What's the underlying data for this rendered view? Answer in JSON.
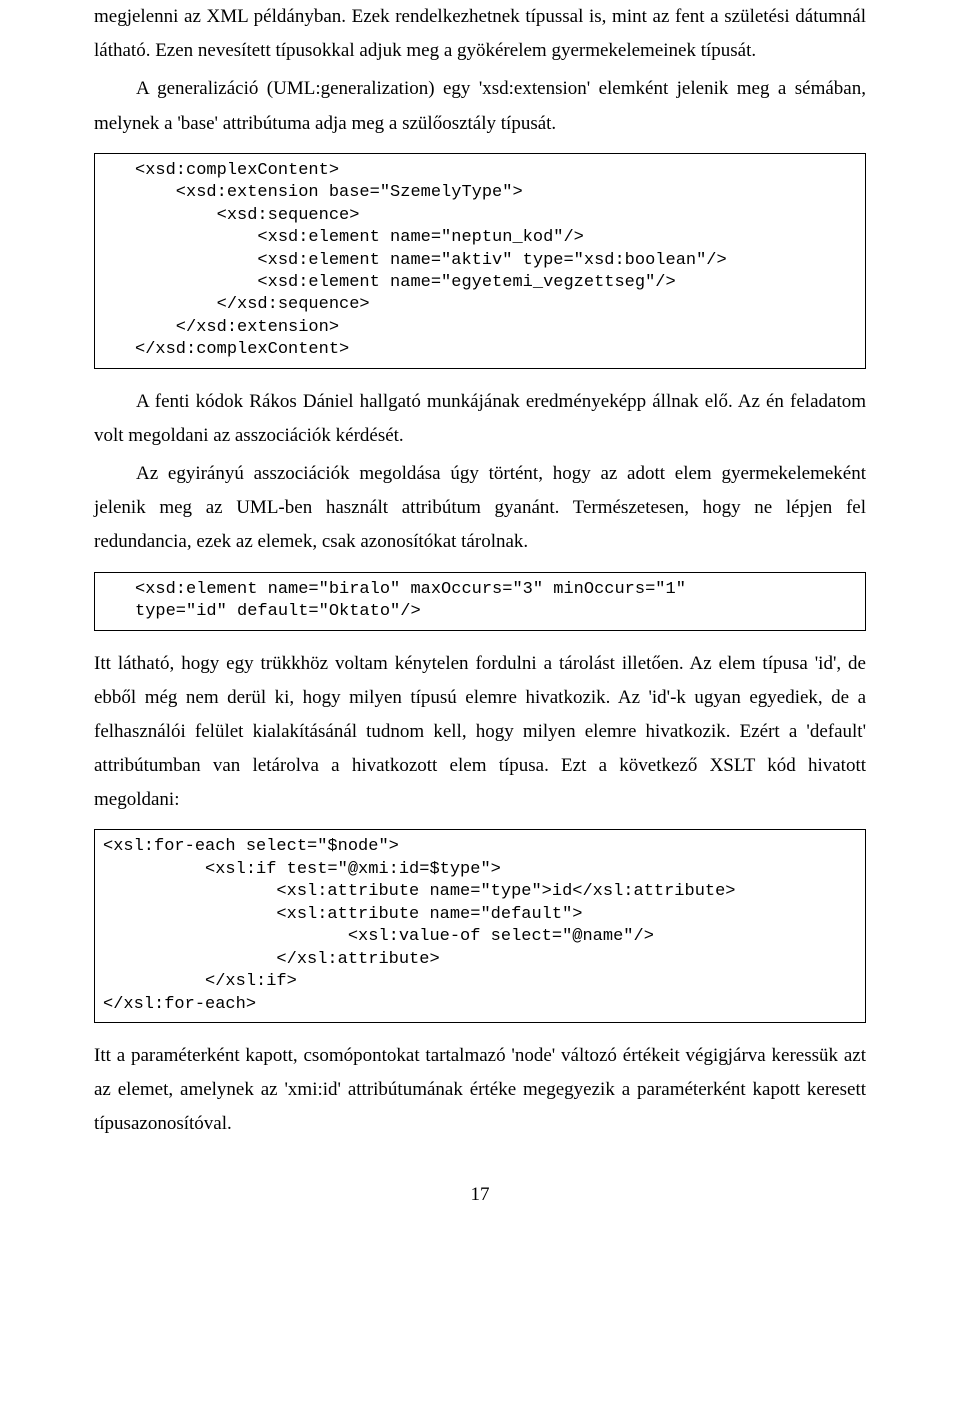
{
  "para1": "megjelenni az XML példányban. Ezek rendelkezhetnek típussal is, mint az fent a születési dátumnál látható. Ezen nevesített típusokkal adjuk meg a gyökérelem gyermekelemeinek típusát.",
  "para2": "A generalizáció (UML:generalization) egy 'xsd:extension' elemként jelenik meg a sémában, melynek a 'base' attribútuma adja meg a szülőosztály típusát.",
  "code1": "<xsd:complexContent>\n    <xsd:extension base=\"SzemelyType\">\n        <xsd:sequence>\n            <xsd:element name=\"neptun_kod\"/>\n            <xsd:element name=\"aktiv\" type=\"xsd:boolean\"/>\n            <xsd:element name=\"egyetemi_vegzettseg\"/>\n        </xsd:sequence>\n    </xsd:extension>\n</xsd:complexContent>",
  "para3": "A fenti kódok Rákos Dániel hallgató munkájának eredményeképp állnak elő. Az én feladatom volt megoldani az asszociációk kérdését.",
  "para4": "Az egyirányú asszociációk megoldása úgy történt, hogy az adott elem gyermekelemeként jelenik meg az UML-ben használt attribútum gyanánt. Természetesen, hogy ne lépjen fel redundancia, ezek az elemek, csak azonosítókat tárolnak.",
  "code2": "<xsd:element name=\"biralo\" maxOccurs=\"3\" minOccurs=\"1\"\ntype=\"id\" default=\"Oktato\"/>",
  "para5": "Itt látható, hogy egy trükkhöz voltam kénytelen fordulni a tárolást illetően. Az elem típusa 'id', de ebből még nem derül ki, hogy milyen típusú elemre hivatkozik. Az 'id'-k ugyan egyediek, de a felhasználói felület kialakításánál tudnom kell, hogy milyen elemre hivatkozik. Ezért a 'default' attribútumban van letárolva a hivatkozott elem típusa. Ezt a következő XSLT kód hivatott megoldani:",
  "code3": "<xsl:for-each select=\"$node\">\n          <xsl:if test=\"@xmi:id=$type\">\n                 <xsl:attribute name=\"type\">id</xsl:attribute>\n                 <xsl:attribute name=\"default\">\n                        <xsl:value-of select=\"@name\"/>\n                 </xsl:attribute>\n          </xsl:if>\n</xsl:for-each>",
  "para6": "Itt a paraméterként kapott, csomópontokat tartalmazó 'node' változó értékeit végigjárva keressük azt az elemet, amelynek az 'xmi:id' attribútumának értéke megegyezik a paraméterként kapott keresett típusazonosítóval.",
  "pageNumber": "17"
}
